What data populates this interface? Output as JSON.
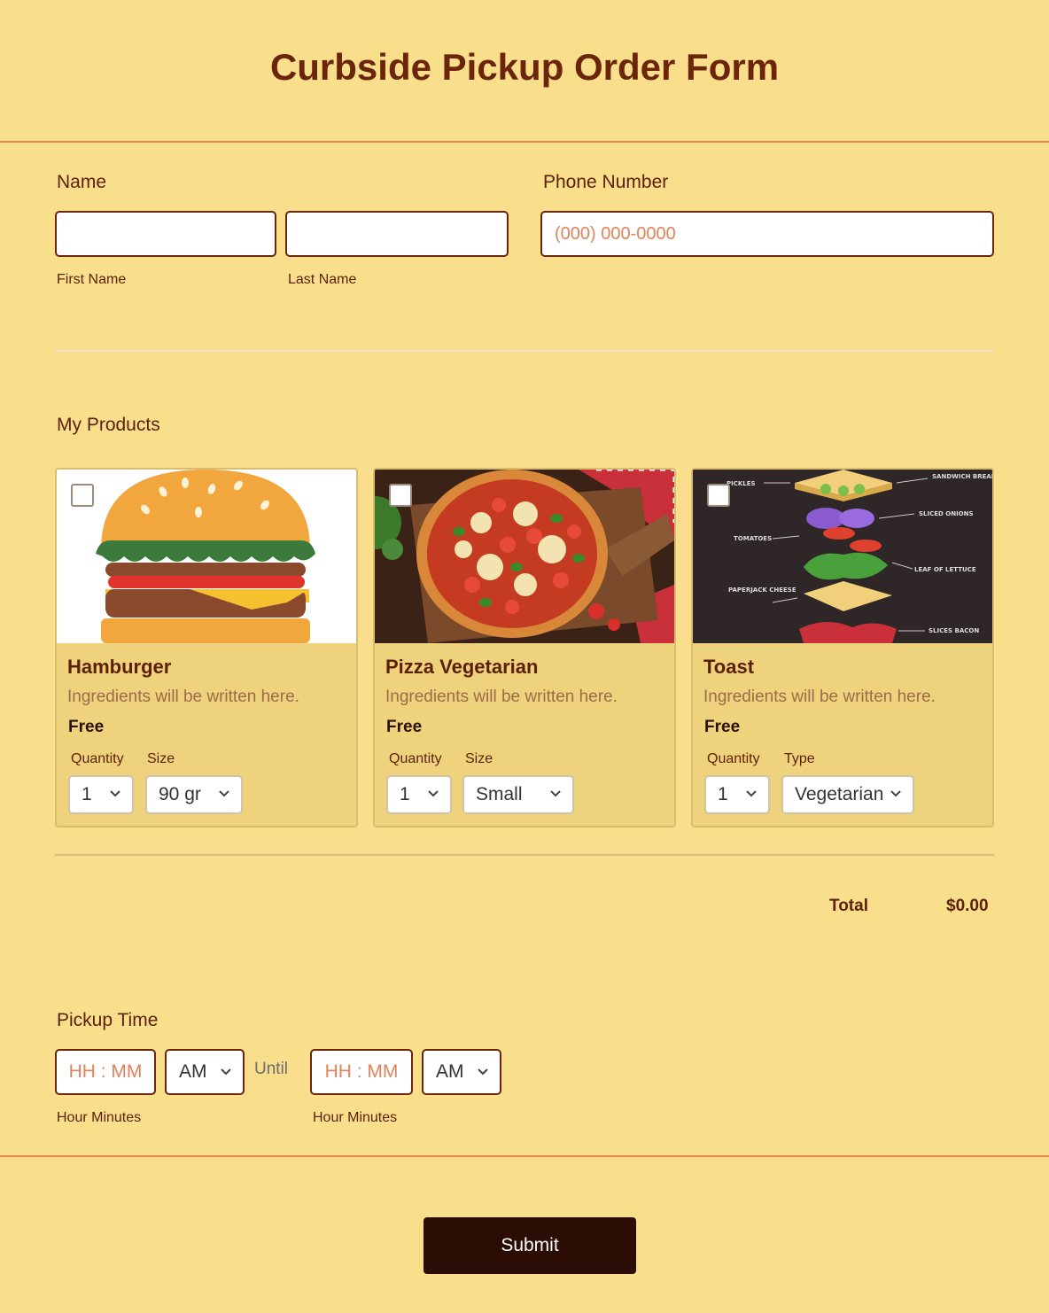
{
  "form": {
    "title": "Curbside Pickup Order Form"
  },
  "name_field": {
    "label": "Name",
    "first_placeholder": "",
    "last_placeholder": "",
    "first_sublabel": "First Name",
    "last_sublabel": "Last Name"
  },
  "phone_field": {
    "label": "Phone Number",
    "placeholder": "(000) 000-0000"
  },
  "products": {
    "label": "My Products",
    "items": [
      {
        "name": "Hamburger",
        "description": "Ingredients will be written here.",
        "price": "Free",
        "quantity_label": "Quantity",
        "quantity_value": "1",
        "option_label": "Size",
        "option_value": "90 gr",
        "image_icon": "hamburger-image"
      },
      {
        "name": "Pizza Vegetarian",
        "description": "Ingredients will be written here.",
        "price": "Free",
        "quantity_label": "Quantity",
        "quantity_value": "1",
        "option_label": "Size",
        "option_value": "Small",
        "image_icon": "pizza-image"
      },
      {
        "name": "Toast",
        "description": "Ingredients will be written here.",
        "price": "Free",
        "quantity_label": "Quantity",
        "quantity_value": "1",
        "option_label": "Type",
        "option_value": "Vegetarian",
        "image_icon": "sandwich-diagram-image"
      }
    ],
    "toast_diagram_labels": [
      "PICKLES",
      "SANDWICH BREAD",
      "SLICED ONIONS",
      "TOMATOES",
      "LEAF OF LETTUCE",
      "PAPERJACK CHEESE",
      "SLICES BACON"
    ],
    "total_label": "Total",
    "total_value": "$0.00"
  },
  "pickup": {
    "label": "Pickup Time",
    "from_placeholder": "HH : MM",
    "from_ampm": "AM",
    "until_label": "Until",
    "to_placeholder": "HH : MM",
    "to_ampm": "AM",
    "from_sublabel": "Hour Minutes",
    "to_sublabel": "Hour Minutes"
  },
  "submit": {
    "label": "Submit"
  },
  "colors": {
    "background": "#f9df8b",
    "title": "#6a250a",
    "accent_rule": "#e8854f",
    "card_bg": "#eed37c",
    "submit_bg": "#2c0d05",
    "placeholder": "#e0835a"
  }
}
